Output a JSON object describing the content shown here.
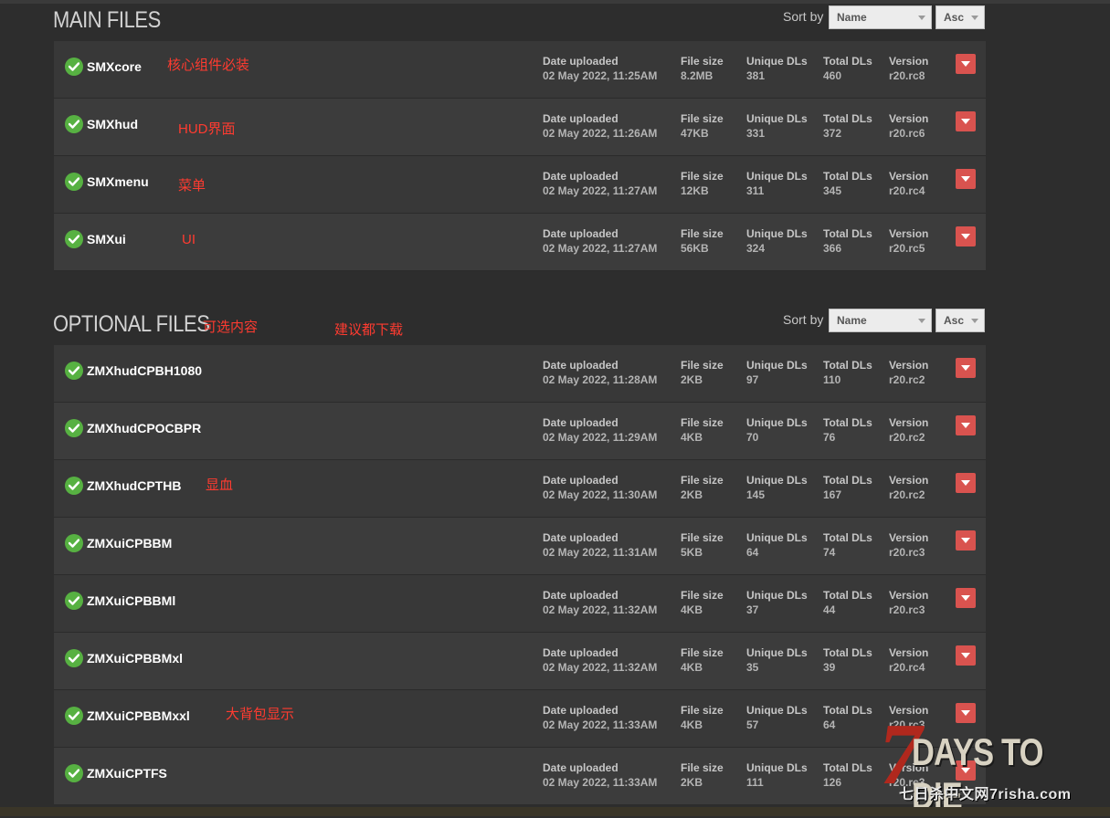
{
  "main": {
    "title": "MAIN FILES",
    "sort_label": "Sort by",
    "sort_field": "Name",
    "sort_order": "Asc",
    "files": [
      {
        "name": "SMXcore",
        "date": "02 May 2022, 11:25AM",
        "size": "8.2MB",
        "unique": "381",
        "total": "460",
        "version": "r20.rc8",
        "note": "核心组件必装"
      },
      {
        "name": "SMXhud",
        "date": "02 May 2022, 11:26AM",
        "size": "47KB",
        "unique": "331",
        "total": "372",
        "version": "r20.rc6",
        "note": "HUD界面"
      },
      {
        "name": "SMXmenu",
        "date": "02 May 2022, 11:27AM",
        "size": "12KB",
        "unique": "311",
        "total": "345",
        "version": "r20.rc4",
        "note": "菜单"
      },
      {
        "name": "SMXui",
        "date": "02 May 2022, 11:27AM",
        "size": "56KB",
        "unique": "324",
        "total": "366",
        "version": "r20.rc5",
        "note": "UI"
      }
    ]
  },
  "optional": {
    "title": "OPTIONAL FILES",
    "note1": "可选内容",
    "note2": "建议都下载",
    "sort_label": "Sort by",
    "sort_field": "Name",
    "sort_order": "Asc",
    "files": [
      {
        "name": "ZMXhudCPBH1080",
        "date": "02 May 2022, 11:28AM",
        "size": "2KB",
        "unique": "97",
        "total": "110",
        "version": "r20.rc2",
        "note": ""
      },
      {
        "name": "ZMXhudCPOCBPR",
        "date": "02 May 2022, 11:29AM",
        "size": "4KB",
        "unique": "70",
        "total": "76",
        "version": "r20.rc2",
        "note": ""
      },
      {
        "name": "ZMXhudCPTHB",
        "date": "02 May 2022, 11:30AM",
        "size": "2KB",
        "unique": "145",
        "total": "167",
        "version": "r20.rc2",
        "note": "显血"
      },
      {
        "name": "ZMXuiCPBBM",
        "date": "02 May 2022, 11:31AM",
        "size": "5KB",
        "unique": "64",
        "total": "74",
        "version": "r20.rc3",
        "note": ""
      },
      {
        "name": "ZMXuiCPBBMl",
        "date": "02 May 2022, 11:32AM",
        "size": "4KB",
        "unique": "37",
        "total": "44",
        "version": "r20.rc3",
        "note": ""
      },
      {
        "name": "ZMXuiCPBBMxl",
        "date": "02 May 2022, 11:32AM",
        "size": "4KB",
        "unique": "35",
        "total": "39",
        "version": "r20.rc4",
        "note": ""
      },
      {
        "name": "ZMXuiCPBBMxxl",
        "date": "02 May 2022, 11:33AM",
        "size": "4KB",
        "unique": "57",
        "total": "64",
        "version": "r20.rc3",
        "note": "大背包显示"
      },
      {
        "name": "ZMXuiCPTFS",
        "date": "02 May 2022, 11:33AM",
        "size": "2KB",
        "unique": "111",
        "total": "126",
        "version": "r20.rc3",
        "note": ""
      }
    ]
  },
  "labels": {
    "date": "Date uploaded",
    "size": "File size",
    "unique": "Unique DLs",
    "total": "Total DLs",
    "version": "Version"
  },
  "watermark": {
    "seven": "7",
    "text": "DAYS TO DIE",
    "sub": "七日杀中文网7risha.com"
  },
  "colors": {
    "check": "#57b142",
    "download_button": "#d9534f",
    "annotation": "#ff3b30"
  },
  "icons": {
    "status": "check-circle-icon",
    "download": "chevron-down-icon"
  }
}
